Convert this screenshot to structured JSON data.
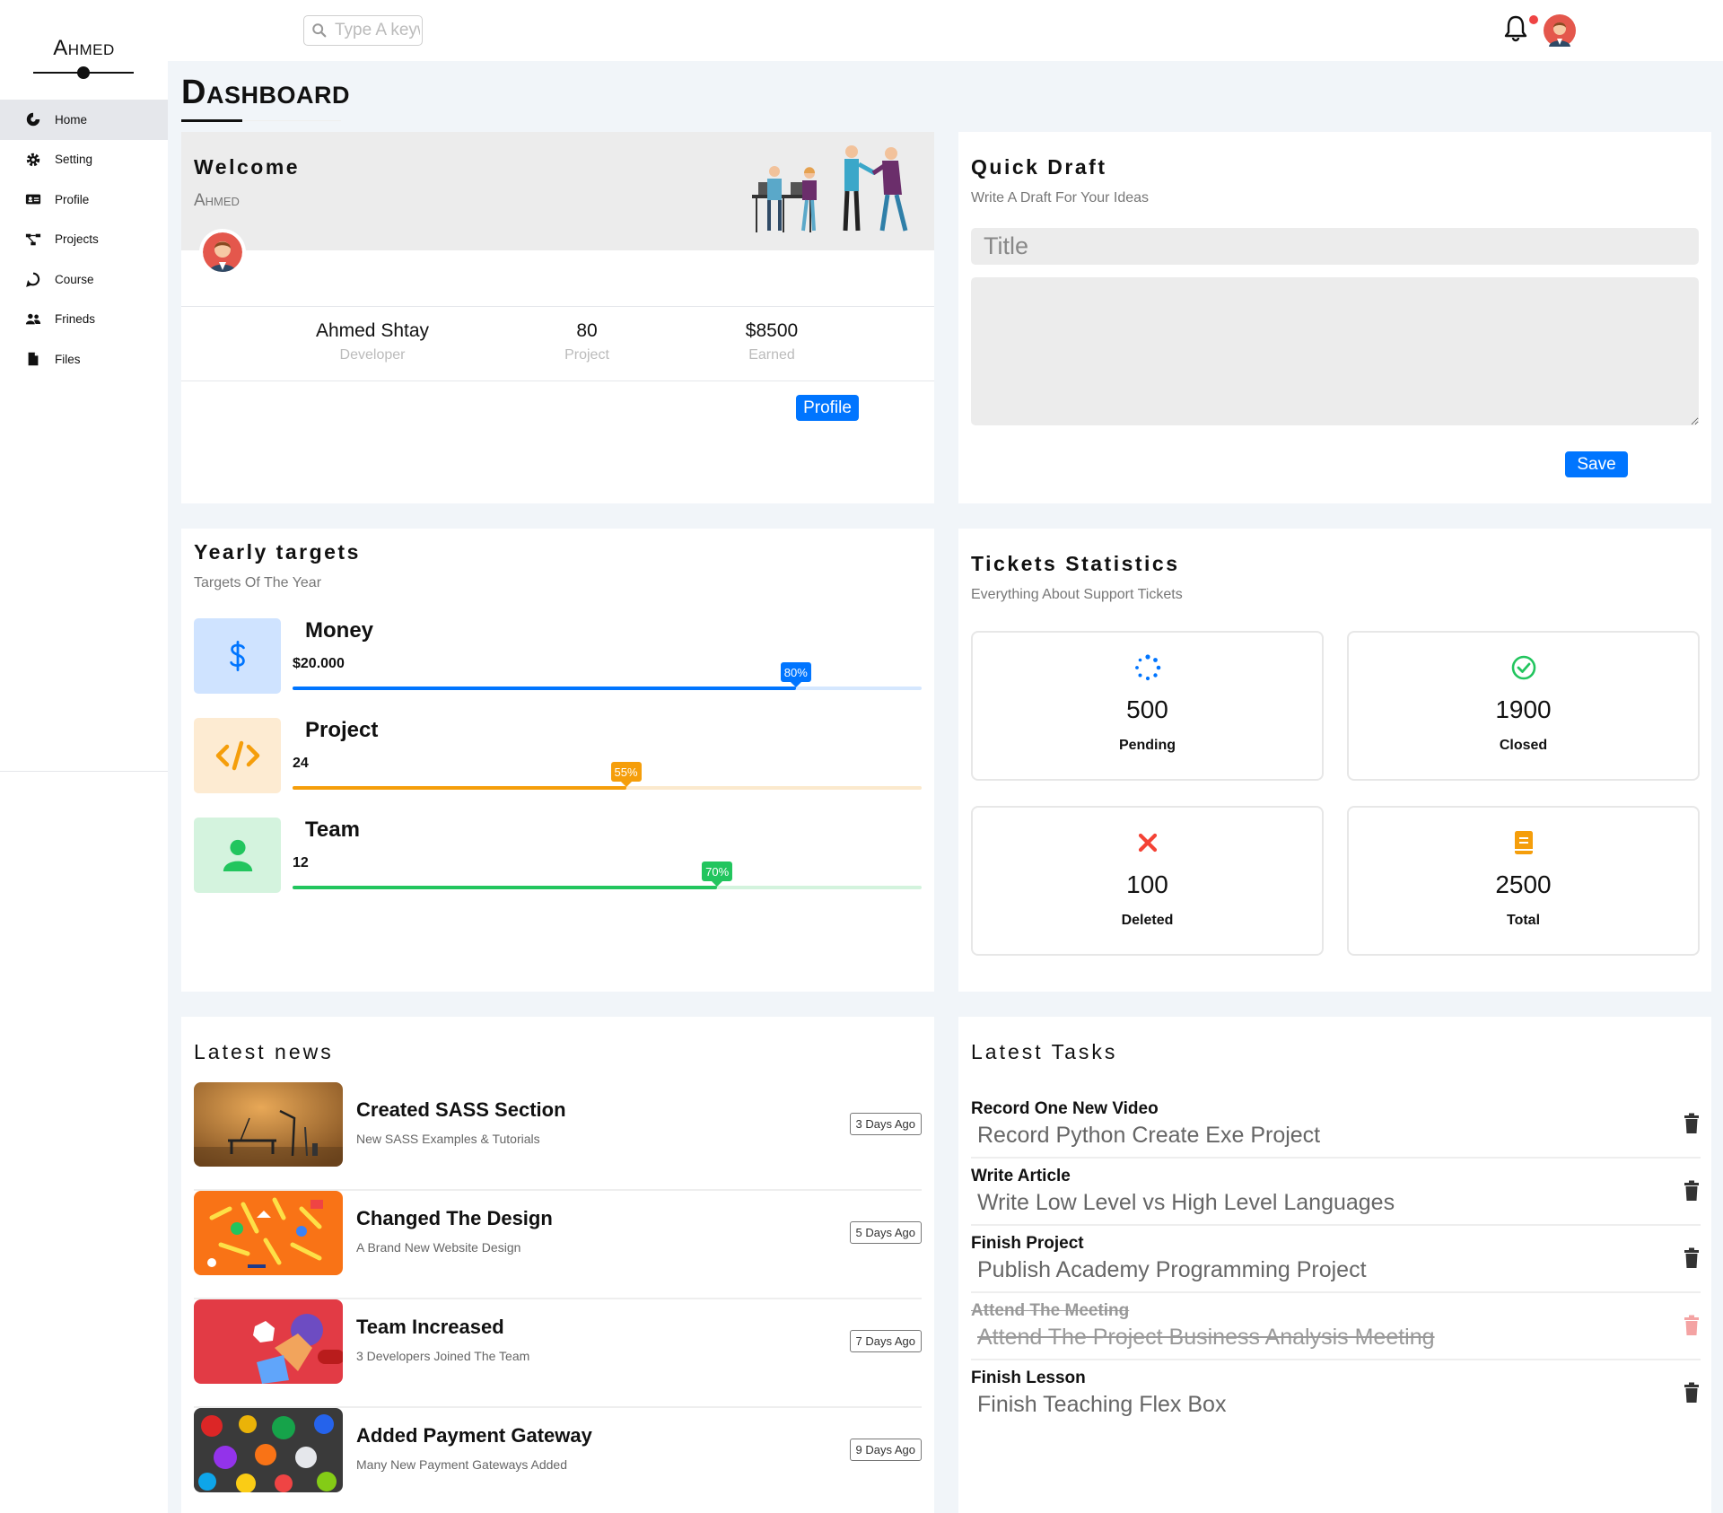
{
  "brand": "Ahmed",
  "sidebar": {
    "items": [
      {
        "label": "Home",
        "icon": "home-icon"
      },
      {
        "label": "Setting",
        "icon": "gear-icon"
      },
      {
        "label": "Profile",
        "icon": "id-card-icon"
      },
      {
        "label": "Projects",
        "icon": "diagram-icon"
      },
      {
        "label": "Course",
        "icon": "chat-icon"
      },
      {
        "label": "Frineds",
        "icon": "users-icon"
      },
      {
        "label": "Files",
        "icon": "file-icon"
      }
    ],
    "active": "Home"
  },
  "topbar": {
    "search_placeholder": "Type A keyword",
    "notification_has_dot": true
  },
  "page_title": "Dashboard",
  "welcome": {
    "title": "Welcome",
    "username": "Ahmed",
    "stats": [
      {
        "value": "Ahmed Shtay",
        "label": "Developer"
      },
      {
        "value": "80",
        "label": "Project"
      },
      {
        "value": "$8500",
        "label": "Earned"
      }
    ],
    "profile_button": "Profile"
  },
  "draft": {
    "title": "Quick Draft",
    "subtitle": "Write A Draft For Your Ideas",
    "title_placeholder": "Title",
    "save_button": "Save"
  },
  "targets": {
    "title": "Yearly targets",
    "subtitle": "Targets Of The Year",
    "items": [
      {
        "name": "Money",
        "value": "$20.000",
        "percent": 80,
        "percent_label": "80%",
        "color": "#0075ff",
        "track": "#d5e7fe",
        "bg": "#cfe3ff",
        "icon": "dollar-icon"
      },
      {
        "name": "Project",
        "value": "24",
        "percent": 55,
        "percent_label": "55%",
        "color": "#f59e0b",
        "track": "#fbe9cd",
        "bg": "#fdebd2",
        "icon": "code-icon"
      },
      {
        "name": "Team",
        "value": "12",
        "percent": 70,
        "percent_label": "70%",
        "color": "#22c55e",
        "track": "#d3f3dd",
        "bg": "#d4f3de",
        "icon": "user-icon"
      }
    ]
  },
  "tickets": {
    "title": "Tickets Statistics",
    "subtitle": "Everything About Support Tickets",
    "items": [
      {
        "value": "500",
        "label": "Pending",
        "icon": "spinner-icon",
        "color": "#0075ff"
      },
      {
        "value": "1900",
        "label": "Closed",
        "icon": "check-circle-icon",
        "color": "#22c55e"
      },
      {
        "value": "100",
        "label": "Deleted",
        "icon": "x-icon",
        "color": "#f44336"
      },
      {
        "value": "2500",
        "label": "Total",
        "icon": "book-icon",
        "color": "#f59e0b"
      }
    ]
  },
  "news": {
    "title": "Latest news",
    "items": [
      {
        "title": "Created SASS Section",
        "subtitle": "New SASS Examples & Tutorials",
        "age": "3 Days Ago"
      },
      {
        "title": "Changed The Design",
        "subtitle": "A Brand New Website Design",
        "age": "5 Days Ago"
      },
      {
        "title": "Team Increased",
        "subtitle": "3 Developers Joined The Team",
        "age": "7 Days Ago"
      },
      {
        "title": "Added Payment Gateway",
        "subtitle": "Many New Payment Gateways Added",
        "age": "9 Days Ago"
      }
    ]
  },
  "tasks": {
    "title": "Latest Tasks",
    "items": [
      {
        "title": "Record One New Video",
        "desc": "Record Python Create Exe Project",
        "done": false
      },
      {
        "title": "Write Article",
        "desc": "Write Low Level vs High Level Languages",
        "done": false
      },
      {
        "title": "Finish Project",
        "desc": "Publish Academy Programming Project",
        "done": false
      },
      {
        "title": "Attend The Meeting",
        "desc": "Attend The Project Business Analysis Meeting",
        "done": true
      },
      {
        "title": "Finish Lesson",
        "desc": "Finish Teaching Flex Box",
        "done": false
      }
    ]
  }
}
